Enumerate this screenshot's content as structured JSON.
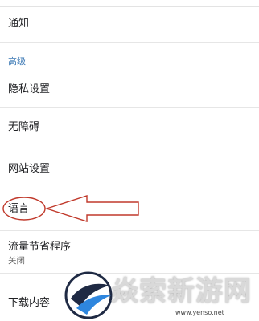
{
  "settings": {
    "notifications_label": "通知",
    "advanced_header": "高级",
    "privacy_label": "隐私设置",
    "accessibility_label": "无障碍",
    "site_settings_label": "网站设置",
    "language_label": "语言",
    "data_saver_label": "流量节省程序",
    "data_saver_status": "关闭",
    "downloads_label": "下载内容"
  },
  "watermark": {
    "brand": "焱索新游网",
    "url": "www.yenso.net"
  },
  "colors": {
    "section_header": "#3b78b4",
    "annotation": "#c0392b"
  }
}
